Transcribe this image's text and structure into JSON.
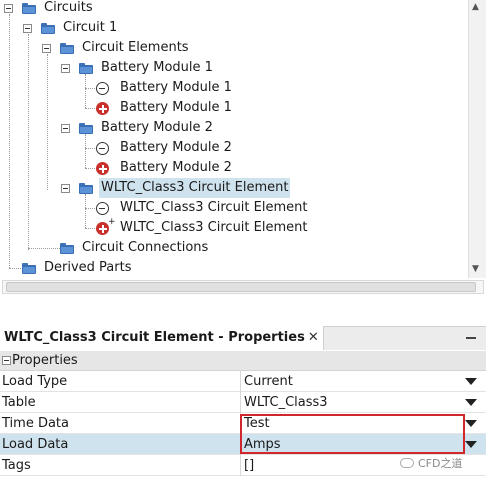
{
  "tree": {
    "items": [
      {
        "label": "Circuits"
      },
      {
        "label": "Circuit 1"
      },
      {
        "label": "Circuit Elements"
      },
      {
        "label": "Battery Module 1"
      },
      {
        "label": "Battery Module 1"
      },
      {
        "label": "Battery Module 1"
      },
      {
        "label": "Battery Module 2"
      },
      {
        "label": "Battery Module 2"
      },
      {
        "label": "Battery Module 2"
      },
      {
        "label": "WLTC_Class3 Circuit Element"
      },
      {
        "label": "WLTC_Class3 Circuit Element"
      },
      {
        "label": "WLTC_Class3 Circuit Element"
      },
      {
        "label": "Circuit Connections"
      },
      {
        "label": "Derived Parts"
      }
    ],
    "selected_item": "WLTC_Class3 Circuit Element",
    "positive_mark": "+"
  },
  "properties": {
    "tab_title": "WLTC_Class3 Circuit Element - Properties",
    "close_glyph": "✕",
    "group_label": "Properties",
    "rows": [
      {
        "name": "Load Type",
        "value": "Current"
      },
      {
        "name": "Table",
        "value": "WLTC_Class3"
      },
      {
        "name": "Time Data",
        "value": "Test"
      },
      {
        "name": "Load Data",
        "value": "Amps"
      },
      {
        "name": "Tags",
        "value": "[]"
      }
    ]
  },
  "watermark": {
    "text": "CFD之道"
  },
  "colors": {
    "selection": "#cfe3ee",
    "highlight_border": "#d0262c",
    "folder": "#3a6fb6",
    "positive_icon": "#c9302c"
  }
}
